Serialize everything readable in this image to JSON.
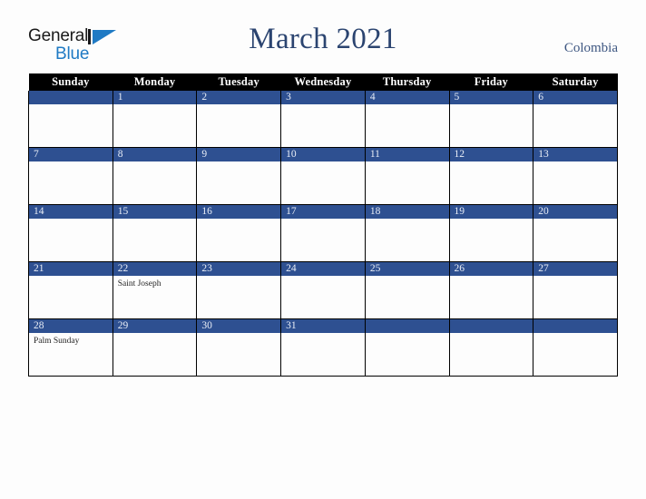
{
  "brand": {
    "name_part1": "General",
    "name_part2": "Blue",
    "mark_icon": "triangle-logo-icon",
    "accent_color": "#1f7ac4"
  },
  "header": {
    "title": "March 2021",
    "country": "Colombia",
    "title_color": "#2b4470"
  },
  "calendar": {
    "weekday_headers": [
      "Sunday",
      "Monday",
      "Tuesday",
      "Wednesday",
      "Thursday",
      "Friday",
      "Saturday"
    ],
    "header_bg": "#000000",
    "daybar_bg": "#2e5091",
    "cell_bg": "#fdfdfd",
    "weeks": [
      [
        {
          "day": "",
          "event": ""
        },
        {
          "day": "1",
          "event": ""
        },
        {
          "day": "2",
          "event": ""
        },
        {
          "day": "3",
          "event": ""
        },
        {
          "day": "4",
          "event": ""
        },
        {
          "day": "5",
          "event": ""
        },
        {
          "day": "6",
          "event": ""
        }
      ],
      [
        {
          "day": "7",
          "event": ""
        },
        {
          "day": "8",
          "event": ""
        },
        {
          "day": "9",
          "event": ""
        },
        {
          "day": "10",
          "event": ""
        },
        {
          "day": "11",
          "event": ""
        },
        {
          "day": "12",
          "event": ""
        },
        {
          "day": "13",
          "event": ""
        }
      ],
      [
        {
          "day": "14",
          "event": ""
        },
        {
          "day": "15",
          "event": ""
        },
        {
          "day": "16",
          "event": ""
        },
        {
          "day": "17",
          "event": ""
        },
        {
          "day": "18",
          "event": ""
        },
        {
          "day": "19",
          "event": ""
        },
        {
          "day": "20",
          "event": ""
        }
      ],
      [
        {
          "day": "21",
          "event": ""
        },
        {
          "day": "22",
          "event": "Saint Joseph"
        },
        {
          "day": "23",
          "event": ""
        },
        {
          "day": "24",
          "event": ""
        },
        {
          "day": "25",
          "event": ""
        },
        {
          "day": "26",
          "event": ""
        },
        {
          "day": "27",
          "event": ""
        }
      ],
      [
        {
          "day": "28",
          "event": "Palm Sunday"
        },
        {
          "day": "29",
          "event": ""
        },
        {
          "day": "30",
          "event": ""
        },
        {
          "day": "31",
          "event": ""
        },
        {
          "day": "",
          "event": ""
        },
        {
          "day": "",
          "event": ""
        },
        {
          "day": "",
          "event": ""
        }
      ]
    ]
  }
}
